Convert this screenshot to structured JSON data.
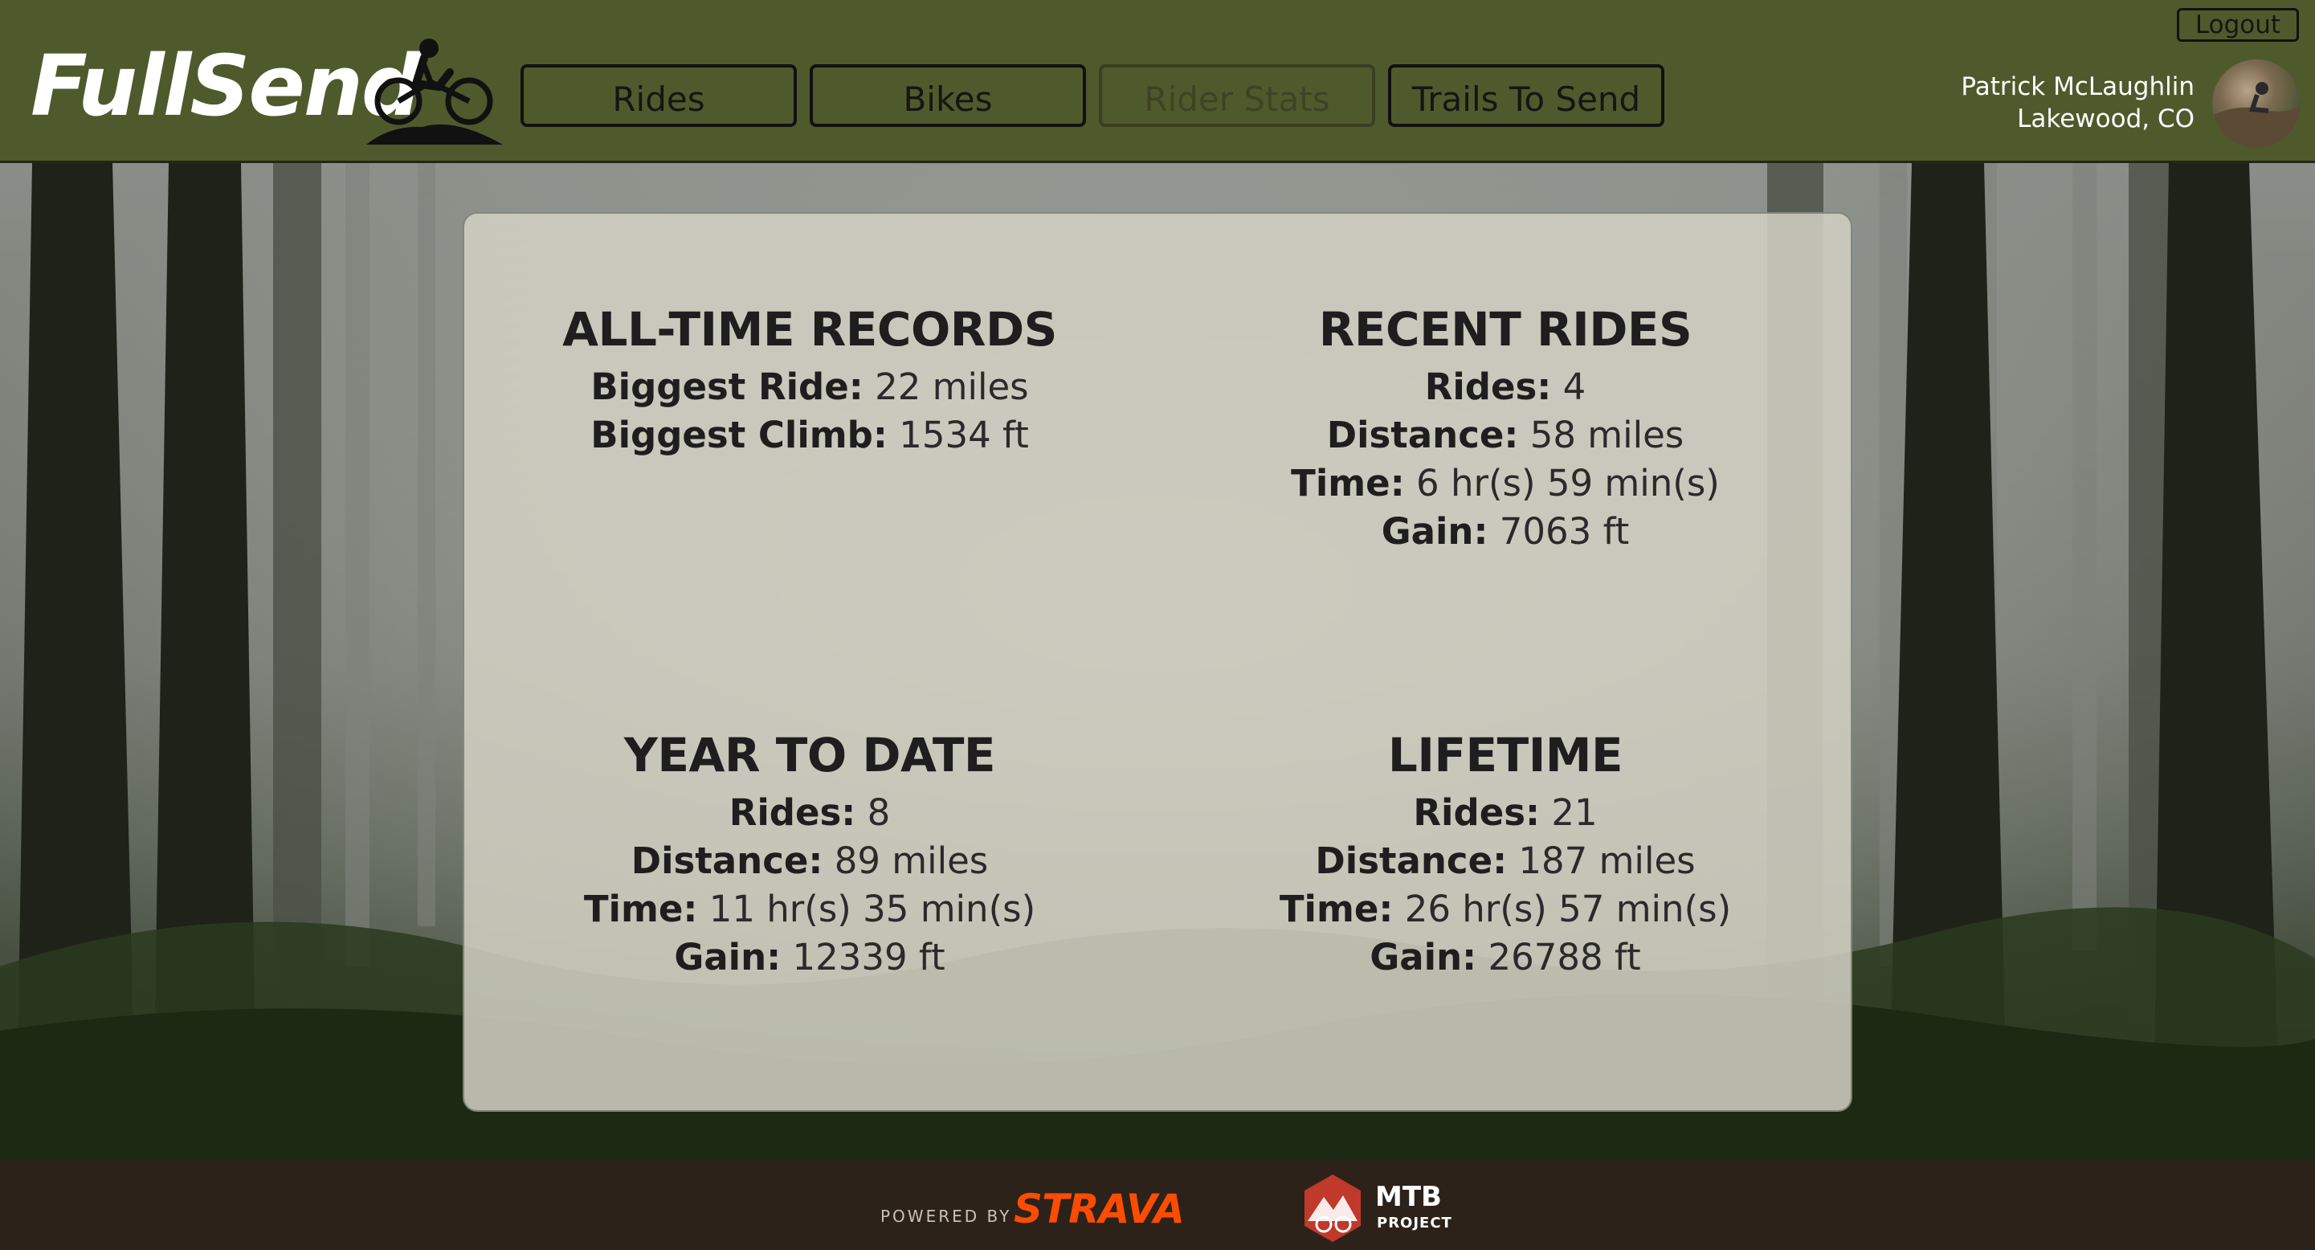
{
  "header": {
    "logo_text": "FullSend",
    "nav": [
      {
        "label": "Rides",
        "state": "active"
      },
      {
        "label": "Bikes",
        "state": "active"
      },
      {
        "label": "Rider Stats",
        "state": "disabled"
      },
      {
        "label": "Trails To Send",
        "state": "active"
      }
    ],
    "logout_label": "Logout",
    "user": {
      "name": "Patrick McLaughlin",
      "location": "Lakewood, CO"
    }
  },
  "stats": {
    "all_time": {
      "title": "ALL-TIME RECORDS",
      "biggest_ride_label": "Biggest Ride:",
      "biggest_ride_value": "22 miles",
      "biggest_climb_label": "Biggest Climb:",
      "biggest_climb_value": "1534 ft"
    },
    "recent": {
      "title": "RECENT RIDES",
      "rides_label": "Rides:",
      "rides_value": "4",
      "distance_label": "Distance:",
      "distance_value": "58 miles",
      "time_label": "Time:",
      "time_value": "6 hr(s) 59 min(s)",
      "gain_label": "Gain:",
      "gain_value": "7063 ft"
    },
    "ytd": {
      "title": "YEAR TO DATE",
      "rides_label": "Rides:",
      "rides_value": "8",
      "distance_label": "Distance:",
      "distance_value": "89 miles",
      "time_label": "Time:",
      "time_value": "11 hr(s) 35 min(s)",
      "gain_label": "Gain:",
      "gain_value": "12339 ft"
    },
    "lifetime": {
      "title": "LIFETIME",
      "rides_label": "Rides:",
      "rides_value": "21",
      "distance_label": "Distance:",
      "distance_value": "187 miles",
      "time_label": "Time:",
      "time_value": "26 hr(s) 57 min(s)",
      "gain_label": "Gain:",
      "gain_value": "26788 ft"
    }
  },
  "footer": {
    "powered_by": "POWERED BY",
    "strava": "STRAVA",
    "mtb_title": "MTB",
    "mtb_sub": "PROJECT"
  },
  "colors": {
    "header_bg": "#4f5a2c",
    "footer_bg": "#2c221a",
    "strava_orange": "#fc4c02",
    "panel_bg": "#d2d0c4"
  }
}
